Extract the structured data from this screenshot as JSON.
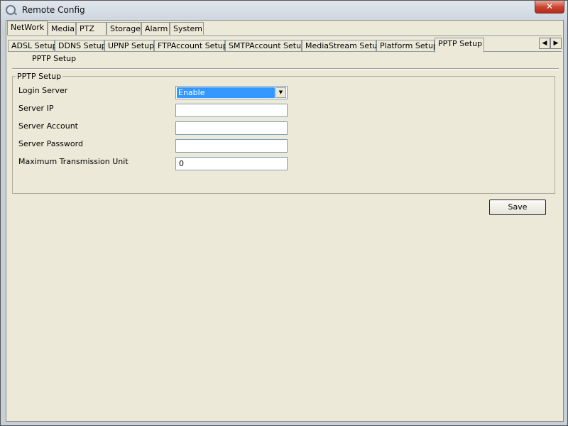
{
  "window": {
    "title": "Remote Config",
    "close_glyph": "✕"
  },
  "main_tabs": [
    "NetWork",
    "Media",
    "PTZ",
    "Storage",
    "Alarm",
    "System"
  ],
  "sub_tabs": [
    "ADSL Setup",
    "DDNS Setup",
    "UPNP Setup",
    "FTPAccount Setup",
    "SMTPAccount Setup",
    "MediaStream Setup",
    "Platform Setup",
    "PPTP Setup"
  ],
  "scroll": {
    "left": "◀",
    "right": "▶"
  },
  "page": {
    "label": "PPTP Setup"
  },
  "group": {
    "title": "PPTP Setup",
    "login_server_label": "Login Server",
    "login_server_value": "Enable",
    "server_ip_label": "Server IP",
    "server_ip_value": "",
    "server_account_label": "Server Account",
    "server_account_value": "",
    "server_password_label": "Server Password",
    "server_password_value": "",
    "mtu_label": "Maximum Transmission Unit",
    "mtu_value": "0"
  },
  "buttons": {
    "save": "Save"
  },
  "icons": {
    "app": "magnifier-icon",
    "dropdown": "chevron-down-icon"
  }
}
